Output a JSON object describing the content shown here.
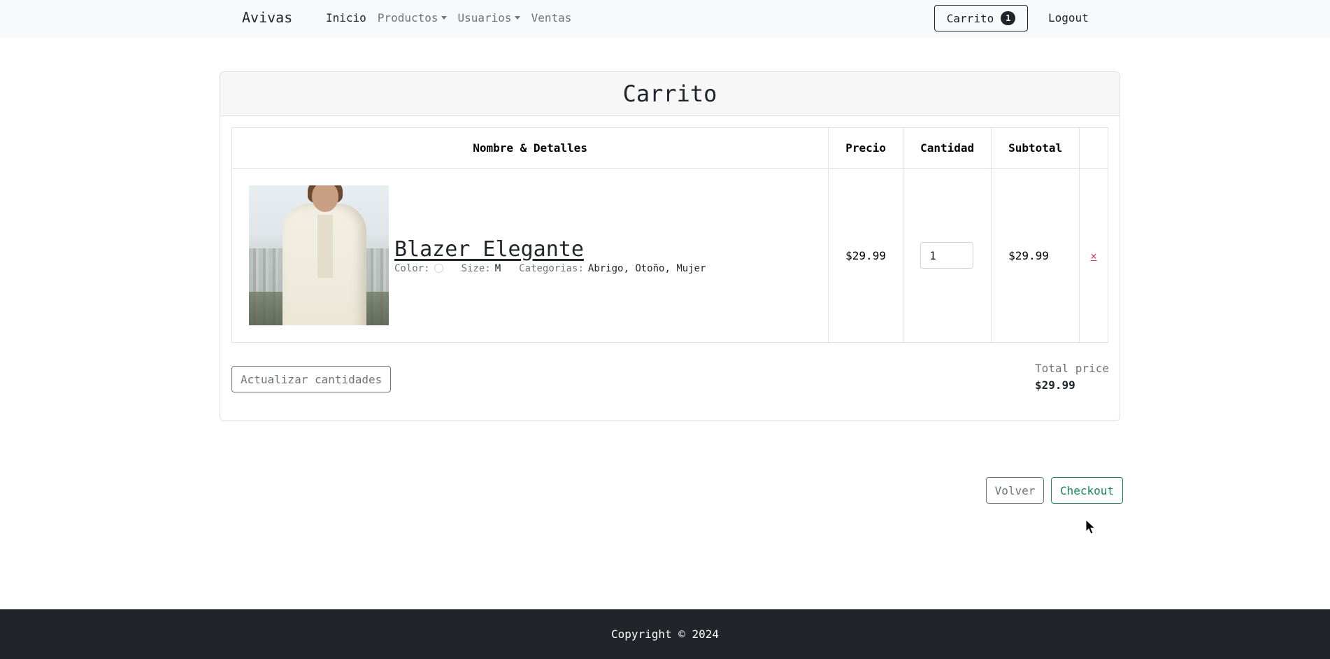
{
  "navbar": {
    "brand": "Avivas",
    "links": [
      {
        "label": "Inicio",
        "active": true,
        "dropdown": false
      },
      {
        "label": "Productos",
        "active": false,
        "dropdown": true
      },
      {
        "label": "Usuarios",
        "active": false,
        "dropdown": true
      },
      {
        "label": "Ventas",
        "active": false,
        "dropdown": false
      }
    ],
    "cart_label": "Carrito",
    "cart_count": "1",
    "logout_label": "Logout"
  },
  "cart": {
    "title": "Carrito",
    "headers": {
      "name": "Nombre & Detalles",
      "price": "Precio",
      "quantity": "Cantidad",
      "subtotal": "Subtotal",
      "remove": ""
    },
    "items": [
      {
        "name": "Blazer Elegante",
        "color_label": "Color:",
        "size_label": "Size:",
        "size": "M",
        "categories_label": "Categorias:",
        "categories": "Abrigo, Otoño, Mujer",
        "price": "$29.99",
        "quantity": "1",
        "subtotal": "$29.99",
        "remove_label": "×"
      }
    ],
    "update_label": "Actualizar cantidades",
    "total_label": "Total price",
    "total_value": "$29.99"
  },
  "actions": {
    "back_label": "Volver",
    "checkout_label": "Checkout"
  },
  "footer": {
    "copyright": "Copyright © 2024"
  },
  "colors": {
    "navbar_bg": "#f8f9fa",
    "footer_bg": "#212529",
    "danger": "#dc3545",
    "success": "#198754",
    "secondary": "#6c757d"
  }
}
